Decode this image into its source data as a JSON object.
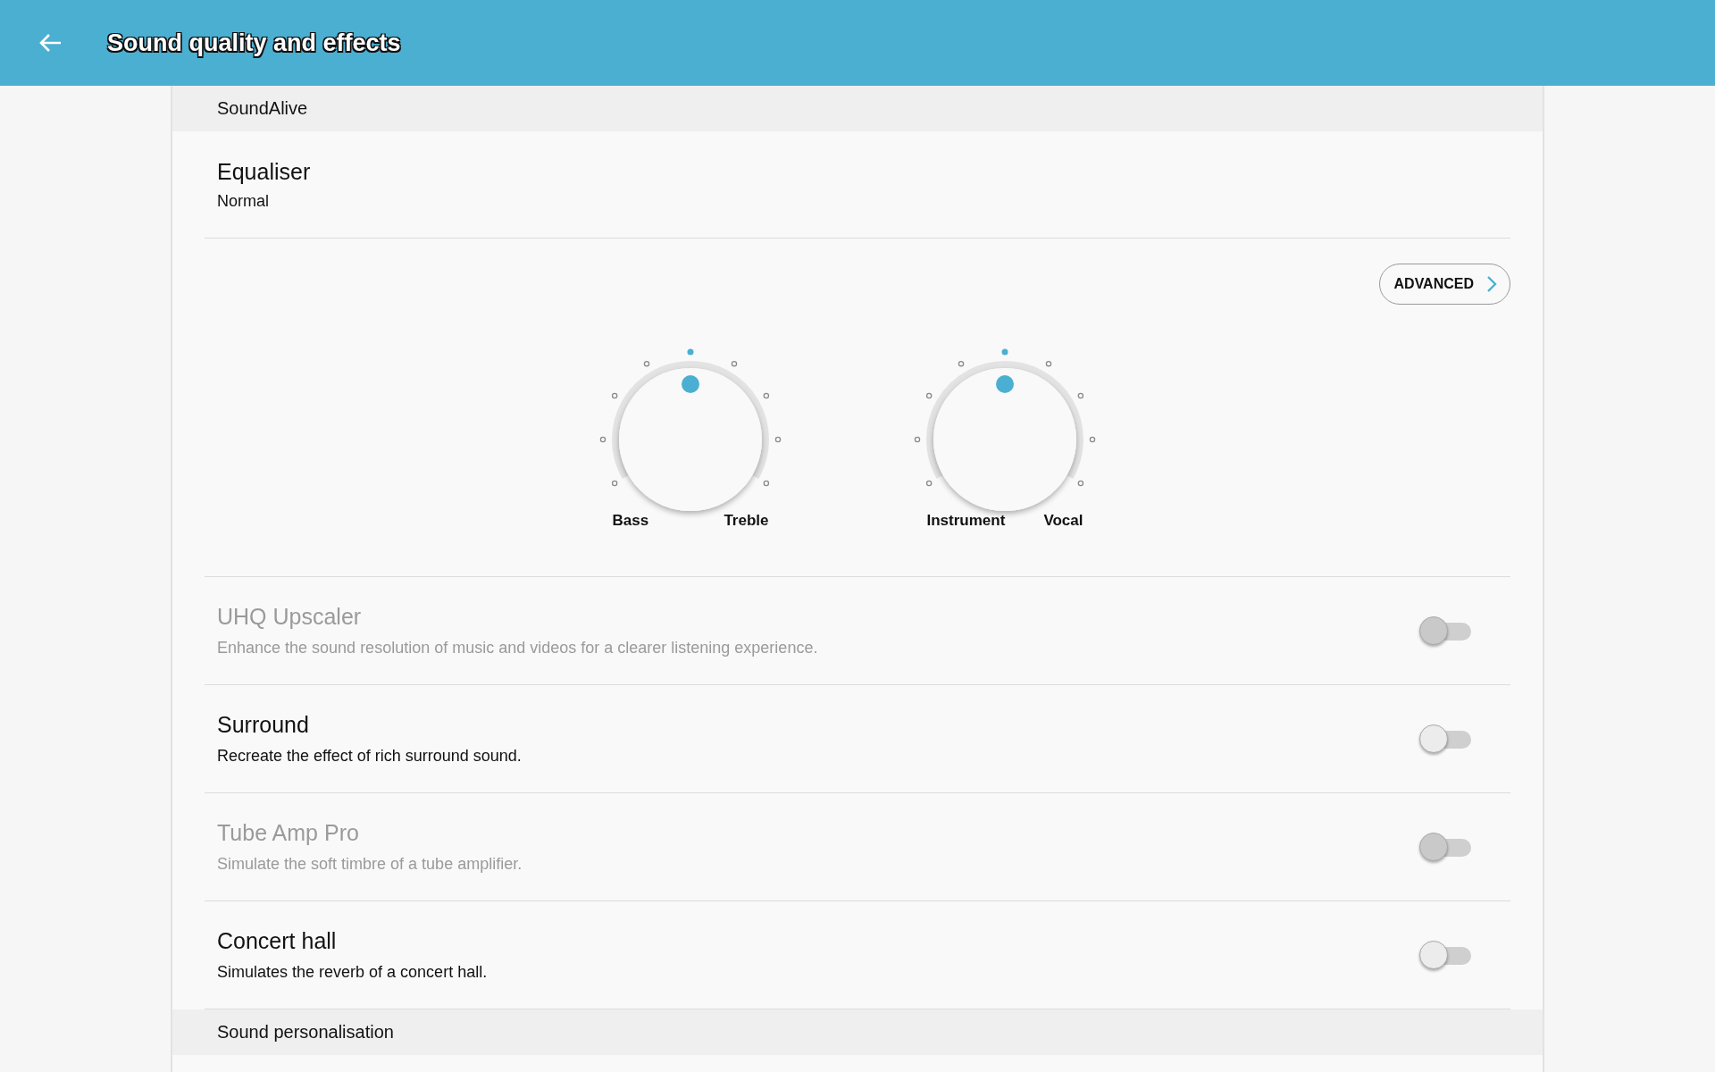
{
  "header": {
    "title": "Sound quality and effects"
  },
  "sections": [
    {
      "title": "SoundAlive",
      "items": [
        {
          "kind": "summary",
          "title": "Equaliser",
          "value": "Normal"
        },
        {
          "kind": "knobs",
          "button": "ADVANCED",
          "knobs": [
            {
              "left_label": "Bass",
              "right_label": "Treble",
              "level": 0.5
            },
            {
              "left_label": "Instrument",
              "right_label": "Vocal",
              "level": 0.5
            }
          ]
        },
        {
          "kind": "switch",
          "title": "UHQ Upscaler",
          "description": "Enhance the sound resolution of music and videos for a clearer listening experience.",
          "on": false,
          "disabled": true
        },
        {
          "kind": "switch",
          "title": "Surround",
          "description": "Recreate the effect of rich surround sound.",
          "on": false,
          "disabled": false
        },
        {
          "kind": "switch",
          "title": "Tube Amp Pro",
          "description": "Simulate the soft timbre of a tube amplifier.",
          "on": false,
          "disabled": true
        },
        {
          "kind": "switch",
          "title": "Concert hall",
          "description": "Simulates the reverb of a concert hall.",
          "on": false,
          "disabled": false
        }
      ]
    },
    {
      "title": "Sound personalisation"
    }
  ]
}
